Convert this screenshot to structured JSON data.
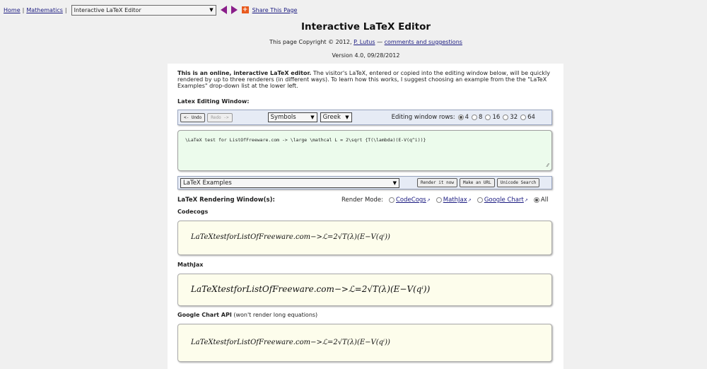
{
  "nav": {
    "home": "Home",
    "math": "Mathematics",
    "page_select": "Interactive LaTeX Editor",
    "share": "Share This Page"
  },
  "header": {
    "title": "Interactive LaTeX Editor",
    "copyright_prefix": "This page Copyright © 2012, ",
    "author": "P. Lutus",
    "dash": " — ",
    "comments": "comments and suggestions",
    "version": "Version 4.0, 09/28/2012"
  },
  "intro": {
    "bold": "This is an online, interactive LaTeX editor.",
    "text": " The visitor's LaTeX, entered or copied into the editing window below, will be quickly rendered by up to three renderers (in different ways). To learn how this works, I suggest choosing an example from the the \"LaTeX Examples\" drop-down list at the lower left."
  },
  "editing": {
    "label": "Latex Editing Window:",
    "undo": "<- Undo",
    "redo": "Redo ->",
    "symbols": "Symbols",
    "greek": "Greek",
    "rows_label": "Editing window rows:",
    "rows": [
      "4",
      "8",
      "16",
      "32",
      "64"
    ],
    "rows_selected": "4",
    "content": "\\LaTeX test for ListOfFreeware.com -> \\large \\mathcal L = 2\\sqrt {T(\\lambda)(E-V(q^i))}"
  },
  "examples": {
    "select": "LaTeX Examples",
    "render_now": "Render it now",
    "make_url": "Make an URL",
    "unicode": "Unicode Search"
  },
  "rendering": {
    "label": "LaTeX Rendering Window(s):",
    "mode_label": "Render Mode:",
    "modes": [
      "CodeCogs",
      "MathJax",
      "Google Chart",
      "All"
    ],
    "mode_selected": "All"
  },
  "renderers": {
    "codecogs": "Codecogs",
    "mathjax": "MathJax",
    "google": "Google Chart API",
    "google_note": " (won't render long equations)"
  },
  "equations": {
    "e1": "LaTeXtestforListOfFreeware.com−>ℒ=2√T(λ)(E−V(qⁱ))",
    "e2": "LaTeXtestforListOfFreeware.com−>ℒ=2√T(λ)(E−V(qⁱ))",
    "e3": "LaTeXtestforListOfFreeware.com−>ℒ=2√T(λ)(E−V(qⁱ))"
  }
}
